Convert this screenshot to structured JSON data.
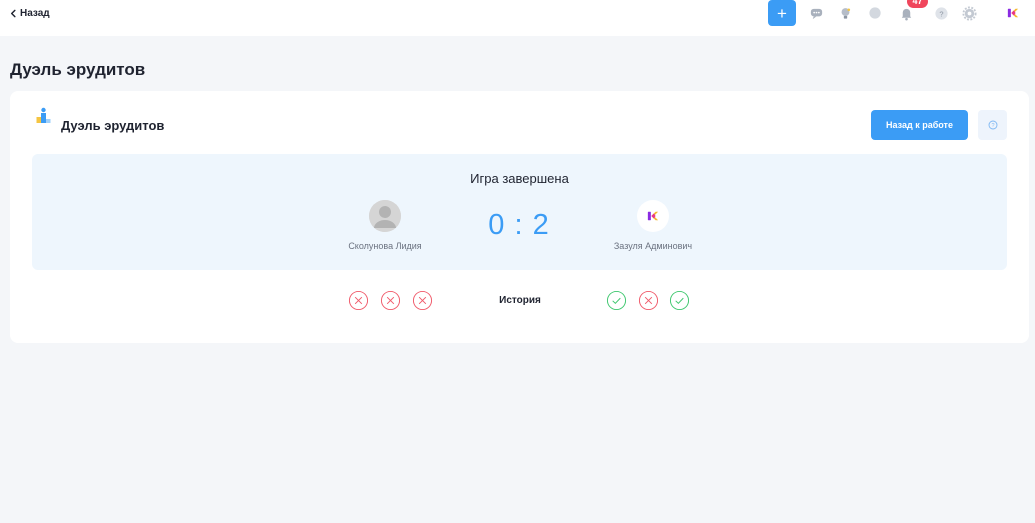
{
  "topbar": {
    "back_label": "Назад",
    "add_label": "+",
    "notifications_count": "47",
    "icons": [
      "chat-icon",
      "idea-bulb-icon",
      "search-icon",
      "bell-icon",
      "help-icon",
      "settings-icon",
      "profile-logo"
    ]
  },
  "page": {
    "title": "Дуэль эрудитов"
  },
  "card": {
    "title": "Дуэль эрудитов",
    "back_to_work_label": "Назад к работе"
  },
  "game": {
    "status": "Игра завершена",
    "player_left": {
      "name": "Сколунова Лидия"
    },
    "player_right": {
      "name": "Зазуля Админович"
    },
    "score": "0 : 2"
  },
  "history": {
    "label": "История",
    "left_results": [
      "wrong",
      "wrong",
      "wrong"
    ],
    "right_results": [
      "correct",
      "wrong",
      "correct"
    ]
  },
  "colors": {
    "accent": "#3b9cf5",
    "badge": "#f0465c",
    "correct": "#3ec76e",
    "wrong": "#f05a6a",
    "panel_bg": "#eef6fd"
  }
}
